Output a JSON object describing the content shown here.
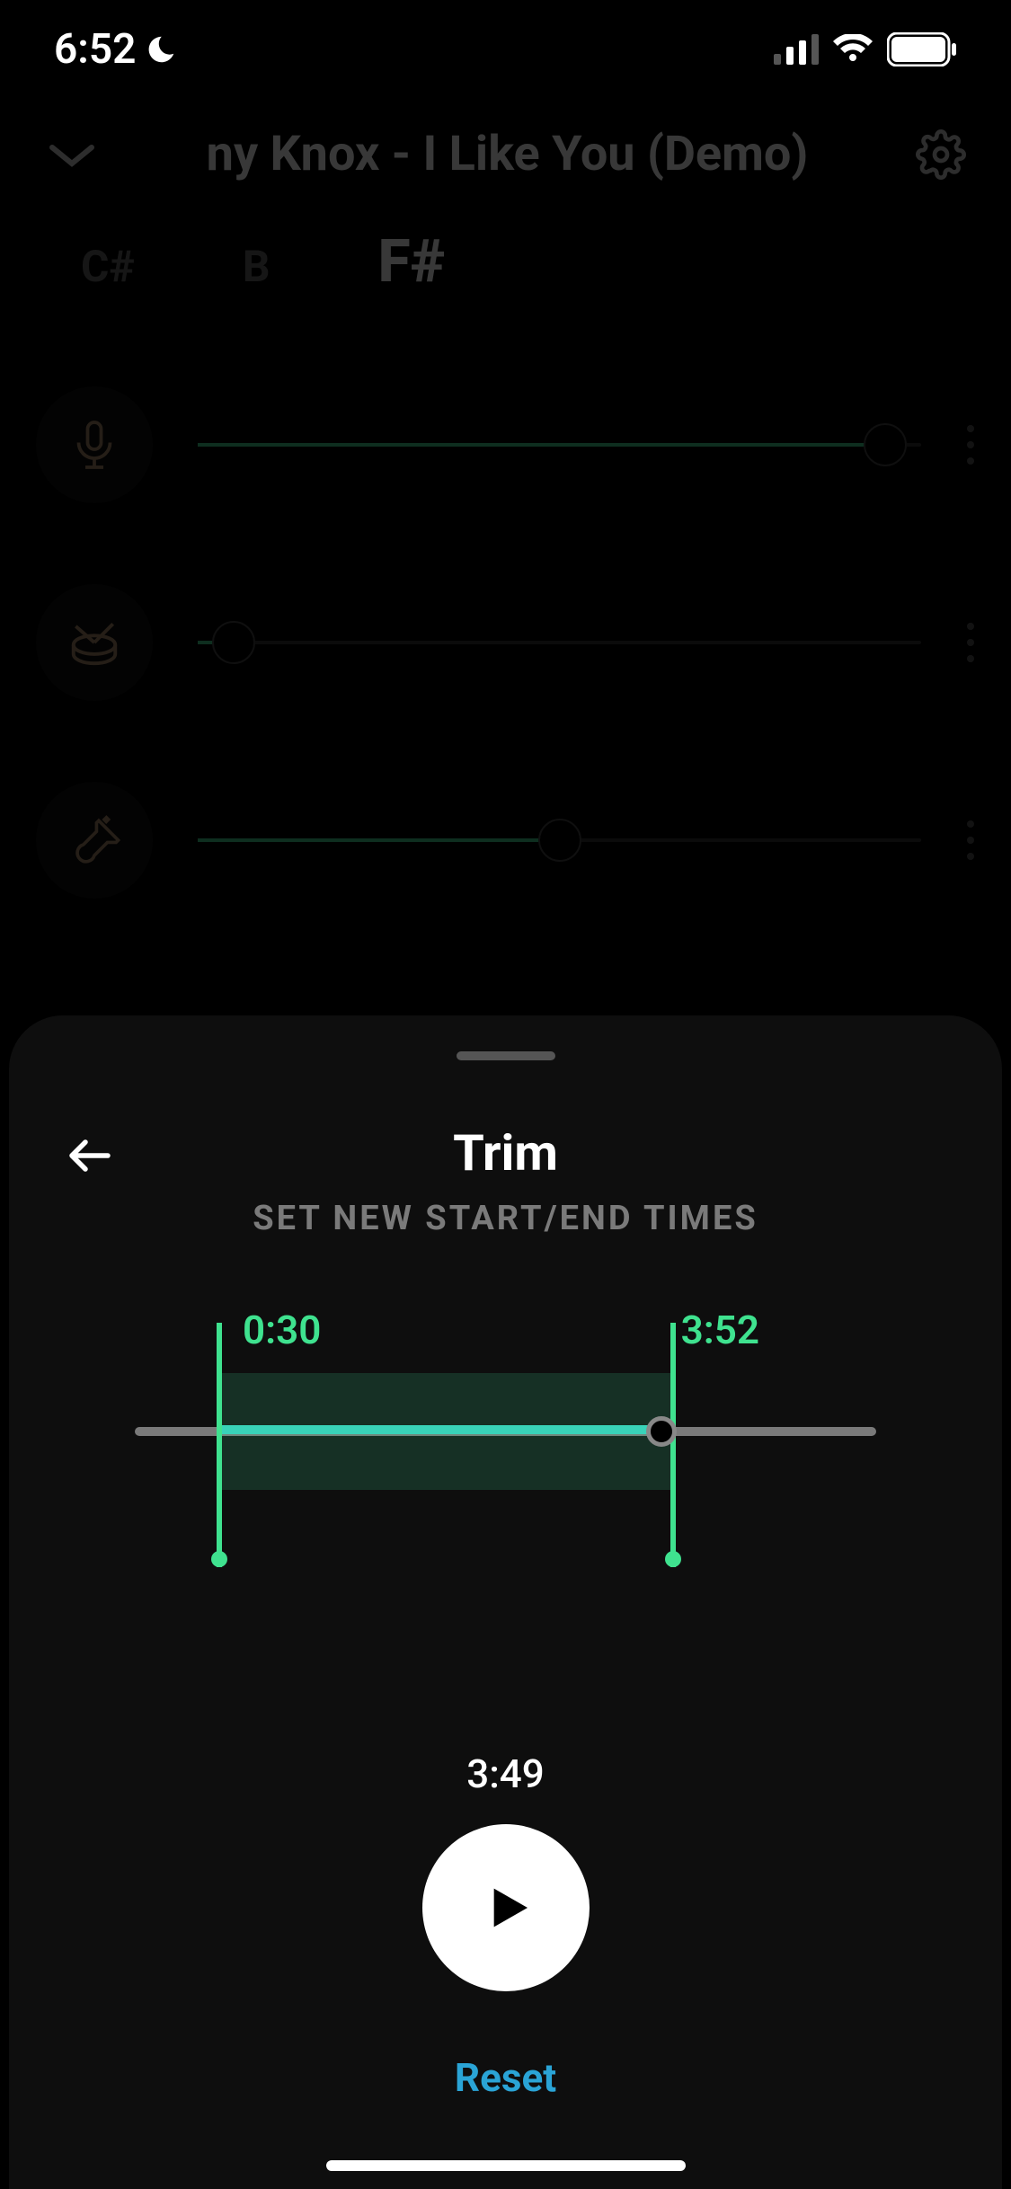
{
  "status": {
    "time": "6:52"
  },
  "bg": {
    "title": "ny Knox - I Like You (Demo)",
    "keys": {
      "k1": "C#",
      "k2": "B",
      "k3": "F#"
    }
  },
  "sheet": {
    "title": "Trim",
    "subtitle": "SET NEW START/END TIMES",
    "start_label": "0:30",
    "end_label": "3:52",
    "trim_start_pct": 11,
    "trim_end_pct": 73,
    "playhead_pct": 71,
    "play_time": "3:49",
    "reset_label": "Reset"
  }
}
